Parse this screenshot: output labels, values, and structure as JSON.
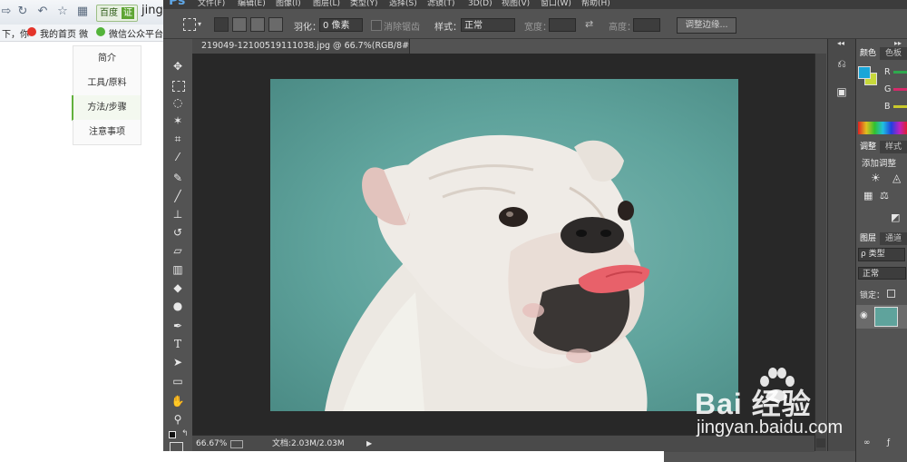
{
  "browser": {
    "baidu_chip_label": "百度",
    "baidu_chip_badge": "证",
    "url_fragment": "jingy",
    "left_fragment": "下，你",
    "bookmarks": [
      {
        "label": "我的首页 微"
      },
      {
        "label": "微信公众平台"
      }
    ]
  },
  "article_nav": {
    "items": [
      {
        "label": "简介",
        "active": false
      },
      {
        "label": "工具/原料",
        "active": false
      },
      {
        "label": "方法/步骤",
        "active": true
      },
      {
        "label": "注意事项",
        "active": false
      }
    ]
  },
  "photoshop": {
    "logo": "Ps",
    "menu": [
      "文件(F)",
      "编辑(E)",
      "图像(I)",
      "图层(L)",
      "类型(Y)",
      "选择(S)",
      "滤镜(T)",
      "3D(D)",
      "视图(V)",
      "窗口(W)",
      "帮助(H)"
    ],
    "options": {
      "feather_label": "羽化：",
      "feather_value": "0 像素",
      "antialias_label": "消除锯齿",
      "style_label": "样式：",
      "style_value": "正常",
      "width_label": "宽度：",
      "height_label": "高度：",
      "refine_edge_button": "调整边缘..."
    },
    "document_tab": "219049-12100519111038.jpg @ 66.7%(RGB/8#)",
    "status": {
      "zoom": "66.67%",
      "doc_info": "文档:2.03M/2.03M"
    },
    "panels": {
      "color_tabs": [
        "颜色",
        "色板"
      ],
      "color_channels": [
        "R",
        "G",
        "B"
      ],
      "adjust_tabs": [
        "调整",
        "样式"
      ],
      "adjust_title": "添加调整",
      "layer_tabs": [
        "图层",
        "通道"
      ],
      "layer_filter": "ρ 类型",
      "blend_mode": "正常",
      "lock_label": "锁定："
    },
    "colors": {
      "foreground": "#1aa6d8",
      "background": "#c7d83a",
      "slider_r": "#2ea84d",
      "slider_g": "#d42a6a",
      "slider_b": "#c9c92b"
    }
  },
  "watermark": {
    "logo_text": "Bai 经验",
    "url": "jingyan.baidu.com"
  }
}
